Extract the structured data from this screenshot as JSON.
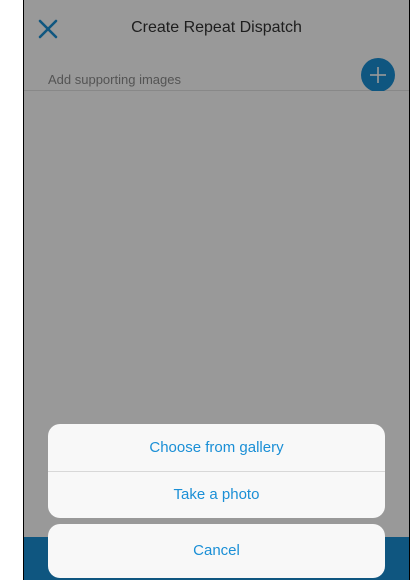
{
  "header": {
    "title": "Create Repeat Dispatch",
    "close_icon": "close-icon"
  },
  "form": {
    "supporting_images_label": "Add supporting images",
    "add_icon": "plus-icon"
  },
  "action_sheet": {
    "options": [
      {
        "label": "Choose from gallery"
      },
      {
        "label": "Take a photo"
      }
    ],
    "cancel_label": "Cancel"
  },
  "colors": {
    "accent": "#1a8fd6",
    "overlay": "rgba(0,0,0,0.40)",
    "sheet_background": "#f8f8f8",
    "title_text": "#333333"
  }
}
